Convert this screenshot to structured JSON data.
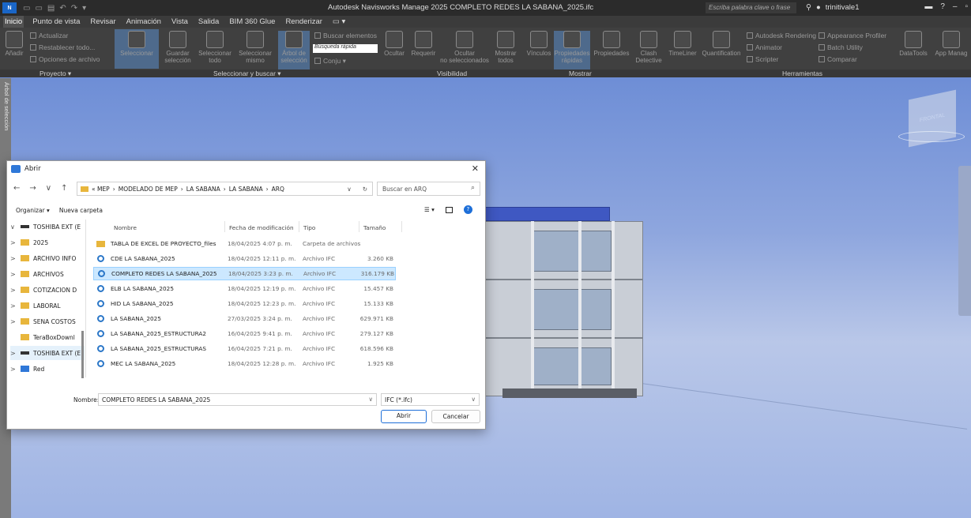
{
  "titlebar": {
    "app_badge": "N",
    "window_title": "Autodesk Navisworks Manage 2025   COMPLETO REDES LA SABANA_2025.ifc",
    "search_placeholder": "Escriba palabra clave o frase",
    "user_name": "trinitivale1"
  },
  "ribbon_tabs": [
    "Inicio",
    "Punto de vista",
    "Revisar",
    "Animación",
    "Vista",
    "Salida",
    "BIM 360 Glue",
    "Renderizar"
  ],
  "ribbon": {
    "proyecto": {
      "add": "Añadir",
      "refresh": "Actualizar",
      "reset_all": "Restablecer todo...",
      "file_options": "Opciones de archivo",
      "label": "Proyecto"
    },
    "seleccionar": {
      "select": "Seleccionar",
      "save_selection_1": "Guardar",
      "save_selection_2": "selección",
      "select_all_1": "Seleccionar",
      "select_all_2": "todo",
      "select_same_1": "Seleccionar",
      "select_same_2": "mismo",
      "selection_tree_1": "Árbol de",
      "selection_tree_2": "selección",
      "find_items": "Buscar elementos",
      "quick_find": "Búsqueda rápida",
      "sets": "Conju",
      "label": "Seleccionar y buscar"
    },
    "visibilidad": {
      "hide": "Ocultar",
      "require": "Requerir",
      "hide_unselected_1": "Ocultar",
      "hide_unselected_2": "no seleccionados",
      "show_all_1": "Mostrar",
      "show_all_2": "todos",
      "label": "Visibilidad"
    },
    "mostrar": {
      "links": "Vínculos",
      "quick_props_1": "Propiedades",
      "quick_props_2": "rápidas",
      "properties": "Propiedades",
      "label": "Mostrar"
    },
    "herramientas": {
      "clash_1": "Clash",
      "clash_2": "Detective",
      "timeliner": "TimeLiner",
      "quantification": "Quantification",
      "rendering": "Autodesk Rendering",
      "animator": "Animator",
      "scripter": "Scripter",
      "appearance": "Appearance Profiler",
      "batch": "Batch Utility",
      "compare": "Comparar",
      "datatools": "DataTools",
      "appmanager": "App Manag",
      "label": "Herramientas"
    }
  },
  "viewport": {
    "side_tab": "Árbol de selección",
    "viewcube_label": "FRONTAL"
  },
  "dialog": {
    "title": "Abrir",
    "breadcrumb": [
      "«  MEP",
      "MODELADO DE MEP",
      "LA SABANA",
      "LA SABANA",
      "ARQ"
    ],
    "search_placeholder": "Buscar en ARQ",
    "organize": "Organizar ▾",
    "new_folder": "Nueva carpeta",
    "tree": [
      {
        "label": "TOSHIBA EXT (E",
        "kind": "drive",
        "chev": "∨"
      },
      {
        "label": "2025",
        "kind": "folder",
        "chev": ">"
      },
      {
        "label": "ARCHIVO INFO",
        "kind": "folder",
        "chev": ">"
      },
      {
        "label": "ARCHIVOS",
        "kind": "folder",
        "chev": ">"
      },
      {
        "label": "COTIZACION D",
        "kind": "folder",
        "chev": ">"
      },
      {
        "label": "LABORAL",
        "kind": "folder",
        "chev": ">"
      },
      {
        "label": "SENA COSTOS",
        "kind": "folder",
        "chev": ">"
      },
      {
        "label": "TeraBoxDownl",
        "kind": "folder",
        "chev": ""
      },
      {
        "label": "TOSHIBA EXT (E",
        "kind": "drive",
        "chev": ">"
      },
      {
        "label": "Red",
        "kind": "net",
        "chev": ">"
      }
    ],
    "columns": {
      "name": "Nombre",
      "date": "Fecha de modificación",
      "type": "Tipo",
      "size": "Tamaño"
    },
    "files": [
      {
        "name": "TABLA DE EXCEL DE PROYECTO_files",
        "date": "18/04/2025 4:07 p. m.",
        "type": "Carpeta de archivos",
        "size": "",
        "kind": "folder"
      },
      {
        "name": "CDE LA SABANA_2025",
        "date": "18/04/2025 12:11 p. m.",
        "type": "Archivo IFC",
        "size": "3.260 KB",
        "kind": "ifc"
      },
      {
        "name": "COMPLETO REDES LA SABANA_2025",
        "date": "18/04/2025 3:23 p. m.",
        "type": "Archivo IFC",
        "size": "316.179 KB",
        "kind": "ifc",
        "selected": true
      },
      {
        "name": "ELB LA SABANA_2025",
        "date": "18/04/2025 12:19 p. m.",
        "type": "Archivo IFC",
        "size": "15.457 KB",
        "kind": "ifc"
      },
      {
        "name": "HID LA SABANA_2025",
        "date": "18/04/2025 12:23 p. m.",
        "type": "Archivo IFC",
        "size": "15.133 KB",
        "kind": "ifc"
      },
      {
        "name": "LA SABANA_2025",
        "date": "27/03/2025 3:24 p. m.",
        "type": "Archivo IFC",
        "size": "629.971 KB",
        "kind": "ifc"
      },
      {
        "name": "LA SABANA_2025_ESTRUCTURA2",
        "date": "16/04/2025 9:41 p. m.",
        "type": "Archivo IFC",
        "size": "279.127 KB",
        "kind": "ifc"
      },
      {
        "name": "LA SABANA_2025_ESTRUCTURAS",
        "date": "16/04/2025 7:21 p. m.",
        "type": "Archivo IFC",
        "size": "618.596 KB",
        "kind": "ifc"
      },
      {
        "name": "MEC LA SABANA_2025",
        "date": "18/04/2025 12:28 p. m.",
        "type": "Archivo IFC",
        "size": "1.925 KB",
        "kind": "ifc"
      }
    ],
    "name_label": "Nombre:",
    "name_value": "COMPLETO REDES LA SABANA_2025",
    "filter_value": "IFC (*.ifc)",
    "open_button": "Abrir",
    "cancel_button": "Cancelar"
  }
}
